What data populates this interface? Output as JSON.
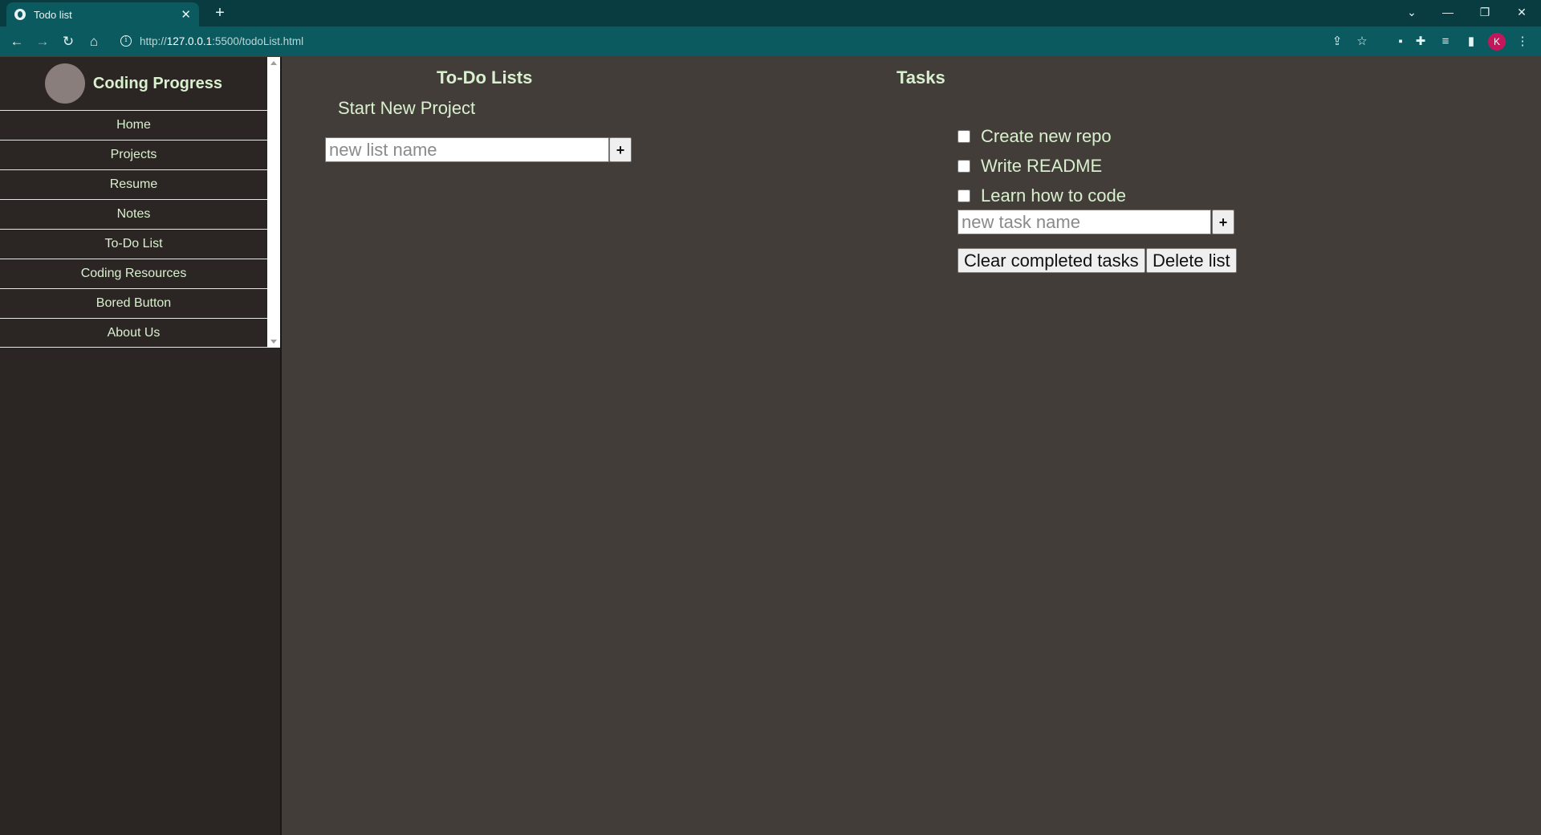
{
  "browser": {
    "tab_title": "Todo list",
    "tab_close": "✕",
    "new_tab": "+",
    "url_prefix": "http://",
    "url_host": "127.0.0.1",
    "url_rest": ":5500/todoList.html",
    "profile_initial": "K"
  },
  "sidebar": {
    "brand_title": "Coding Progress",
    "items": [
      {
        "label": "Home"
      },
      {
        "label": "Projects"
      },
      {
        "label": "Resume"
      },
      {
        "label": "Notes"
      },
      {
        "label": "To-Do List"
      },
      {
        "label": "Coding Resources"
      },
      {
        "label": "Bored Button"
      },
      {
        "label": "About Us"
      }
    ]
  },
  "lists_panel": {
    "title": "To-Do Lists",
    "project_link": "Start New Project",
    "new_list_placeholder": "new list name",
    "add_label": "+"
  },
  "tasks_panel": {
    "title": "Tasks",
    "tasks": [
      {
        "label": "Create new repo",
        "checked": false
      },
      {
        "label": "Write README",
        "checked": false
      },
      {
        "label": "Learn how to code",
        "checked": false
      }
    ],
    "new_task_placeholder": "new task name",
    "add_label": "+",
    "clear_label": "Clear completed tasks",
    "delete_label": "Delete list"
  },
  "colors": {
    "page_bg": "#433d39",
    "sidebar_bg": "#2b2624",
    "text_accent": "#d9f0cf",
    "chrome_bg": "#083c40",
    "toolbar_bg": "#0b5a5f"
  }
}
